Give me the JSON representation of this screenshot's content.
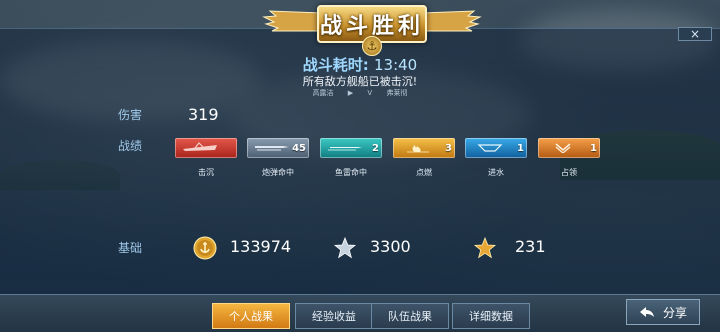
{
  "header": {
    "title": "战斗胜利",
    "close_icon": "×",
    "time_label": "战斗耗时:",
    "time_value": "13:40",
    "result_text": "所有敌方舰船已被击沉!",
    "left_player": "高露洁",
    "vs": "V",
    "right_player": "弗莱彻"
  },
  "stats": {
    "damage_label": "伤害",
    "damage_value": "319",
    "achievements_label": "战绩",
    "medals": [
      {
        "name": "击沉",
        "count": "",
        "color": "#c8322a",
        "icon": "ship-sunk-icon"
      },
      {
        "name": "炮弹命中",
        "count": "45",
        "color": "#6a7c90",
        "icon": "shell-hit-icon"
      },
      {
        "name": "鱼雷命中",
        "count": "2",
        "color": "#1aa0a0",
        "icon": "torpedo-hit-icon"
      },
      {
        "name": "点燃",
        "count": "3",
        "color": "#e09a18",
        "icon": "fire-icon"
      },
      {
        "name": "进水",
        "count": "1",
        "color": "#1a86c6",
        "icon": "flooding-icon"
      },
      {
        "name": "占领",
        "count": "1",
        "color": "#e07a22",
        "icon": "capture-icon"
      }
    ],
    "base_label": "基础",
    "base": {
      "coins": "133974",
      "exp": "3300",
      "rank": "231"
    }
  },
  "tabs": [
    "个人战果",
    "经验收益",
    "队伍战果",
    "详细数据"
  ],
  "active_tab": 0,
  "share_label": "分享",
  "colors": {
    "gold": "#d8a238",
    "accent_blue": "#9fd8ff",
    "active_tab": "#e89a2a"
  }
}
